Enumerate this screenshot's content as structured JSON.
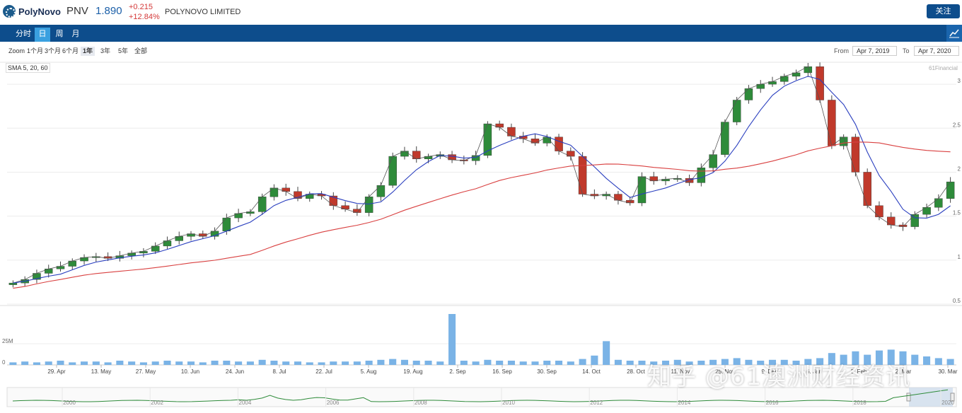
{
  "header": {
    "logo_text": "PolyNovo",
    "ticker": "PNV",
    "price": "1.890",
    "change_abs": "+0.215",
    "change_pct": "+12.84%",
    "company": "POLYNOVO LIMITED",
    "follow_label": "关注"
  },
  "tabs": [
    {
      "label": "分时",
      "active": false
    },
    {
      "label": "日",
      "active": true
    },
    {
      "label": "周",
      "active": false
    },
    {
      "label": "月",
      "active": false
    }
  ],
  "zoom": {
    "label": "Zoom",
    "options": [
      "1个月",
      "3个月",
      "6个月",
      "1年",
      "3年",
      "5年",
      "全部"
    ],
    "active": "1年"
  },
  "range": {
    "from_label": "From",
    "from_value": "Apr 7, 2019",
    "to_label": "To",
    "to_value": "Apr 7, 2020"
  },
  "indicator_label": "SMA 5, 20, 60",
  "credit": "61Financial",
  "watermark": "知乎 @61澳洲财经资讯",
  "colors": {
    "brand": "#0d4d8c",
    "up": "#2e8b3a",
    "down": "#c0392b",
    "sma5": "#555555",
    "sma20": "#2a3fbf",
    "sma60": "#d94040",
    "volume": "#7ab3e6",
    "navigator": "#2e8b3a"
  },
  "chart_data": {
    "type": "candlestick",
    "price_axis": {
      "ticks": [
        0.5,
        1,
        1.5,
        2,
        2.5,
        3
      ],
      "tick_labels": [
        "0.5",
        "1",
        "1.5",
        "2",
        "2.5",
        "3"
      ],
      "range": [
        0.5,
        3.25
      ],
      "position": "right"
    },
    "x_tick_labels": [
      "29. Apr",
      "13. May",
      "27. May",
      "10. Jun",
      "24. Jun",
      "8. Jul",
      "22. Jul",
      "5. Aug",
      "19. Aug",
      "2. Sep",
      "16. Sep",
      "30. Sep",
      "14. Oct",
      "28. Oct",
      "11. Nov",
      "25. Nov",
      "9. Dec",
      "6. Jan",
      "3. Feb",
      "2. Mar",
      "30. Mar"
    ],
    "volume_axis": {
      "tick_labels": [
        "0",
        "25M"
      ],
      "range": [
        0,
        70
      ]
    },
    "close_series": [
      0.74,
      0.78,
      0.85,
      0.9,
      0.93,
      0.99,
      1.03,
      1.04,
      1.02,
      1.05,
      1.08,
      1.1,
      1.16,
      1.22,
      1.27,
      1.3,
      1.27,
      1.33,
      1.48,
      1.53,
      1.55,
      1.72,
      1.82,
      1.78,
      1.7,
      1.75,
      1.73,
      1.62,
      1.58,
      1.54,
      1.72,
      1.85,
      2.18,
      2.24,
      2.15,
      2.18,
      2.2,
      2.14,
      2.13,
      2.19,
      2.55,
      2.51,
      2.41,
      2.38,
      2.33,
      2.4,
      2.24,
      2.18,
      1.75,
      1.73,
      1.75,
      1.68,
      1.65,
      1.95,
      1.9,
      1.92,
      1.93,
      1.88,
      2.05,
      2.2,
      2.57,
      2.82,
      2.95,
      3.0,
      3.03,
      3.09,
      3.13,
      3.2,
      2.82,
      2.3,
      2.4,
      2.0,
      1.62,
      1.49,
      1.4,
      1.38,
      1.52,
      1.6,
      1.7,
      1.89
    ],
    "sma_series": [
      {
        "name": "SMA 5",
        "period": 5
      },
      {
        "name": "SMA 20",
        "period": 20
      },
      {
        "name": "SMA 60",
        "period": 60
      }
    ],
    "volume_series": [
      3,
      4,
      3,
      4,
      5,
      3,
      4,
      4,
      3,
      5,
      4,
      3,
      4,
      5,
      4,
      4,
      3,
      5,
      5,
      4,
      4,
      6,
      5,
      4,
      4,
      3,
      3,
      4,
      4,
      4,
      5,
      6,
      7,
      6,
      5,
      5,
      4,
      60,
      5,
      4,
      6,
      5,
      5,
      4,
      4,
      5,
      5,
      4,
      7,
      11,
      28,
      6,
      5,
      5,
      4,
      5,
      6,
      4,
      5,
      6,
      7,
      8,
      6,
      5,
      6,
      6,
      5,
      7,
      8,
      14,
      12,
      16,
      12,
      17,
      18,
      16,
      12,
      10,
      8,
      7
    ],
    "navigator": {
      "x_tick_labels": [
        "2000",
        "2002",
        "2004",
        "2006",
        "2008",
        "2010",
        "2012",
        "2014",
        "2016",
        "2018",
        "2020"
      ]
    }
  }
}
